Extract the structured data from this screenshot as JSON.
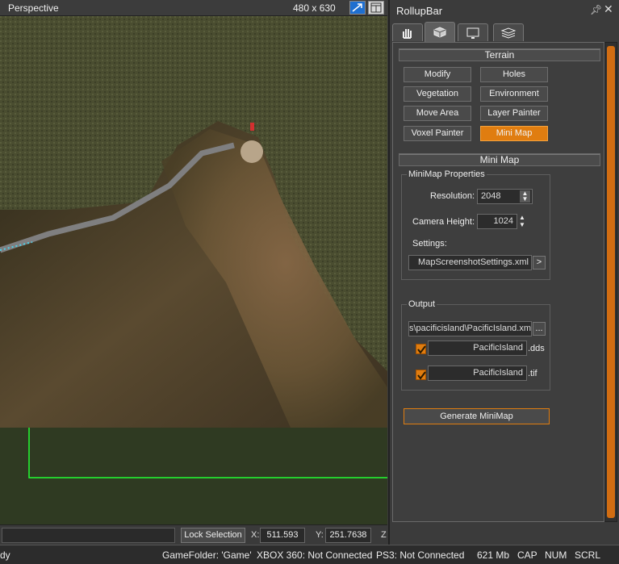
{
  "viewport": {
    "title": "Perspective",
    "size_label": "480 x 630",
    "maximize_icon": "maximize-icon",
    "layout_icon": "layout-icon"
  },
  "coords": {
    "lock_selection": "Lock Selection",
    "x_label": "X:",
    "x_value": "511.593",
    "y_label": "Y:",
    "y_value": "251.7638",
    "z_label": "Z"
  },
  "status": {
    "ready": "dy",
    "game_folder": "GameFolder: 'Game'",
    "xbox": "XBOX 360: Not Connected",
    "ps3": "PS3: Not Connected",
    "memory": "621 Mb",
    "cap": "CAP",
    "num": "NUM",
    "scrl": "SCRL"
  },
  "rollup": {
    "title": "RollupBar",
    "tabs": [
      "hand-icon",
      "objects-icon",
      "display-icon",
      "layers-icon"
    ],
    "terrain": {
      "header": "Terrain",
      "buttons": [
        "Modify",
        "Holes",
        "Vegetation",
        "Environment",
        "Move Area",
        "Layer Painter",
        "Voxel Painter",
        "Mini Map"
      ],
      "active": "Mini Map"
    },
    "minimap": {
      "header": "Mini Map",
      "properties_title": "MiniMap Properties",
      "resolution_label": "Resolution:",
      "resolution_value": "2048",
      "camera_height_label": "Camera Height:",
      "camera_height_value": "1024",
      "settings_label": "Settings:",
      "settings_value": "MapScreenshotSettings.xml",
      "settings_browse": ">",
      "output_title": "Output",
      "output_path": "s\\pacificisland\\PacificIsland.xml",
      "output_browse": "...",
      "dds_name": "PacificIsland",
      "dds_ext": ".dds",
      "tif_name": "PacificIsland",
      "tif_ext": ".tif",
      "generate": "Generate MiniMap"
    }
  },
  "colors": {
    "accent": "#e07d10",
    "panel": "#3e3e3e",
    "selection_line": "#22ff33"
  }
}
